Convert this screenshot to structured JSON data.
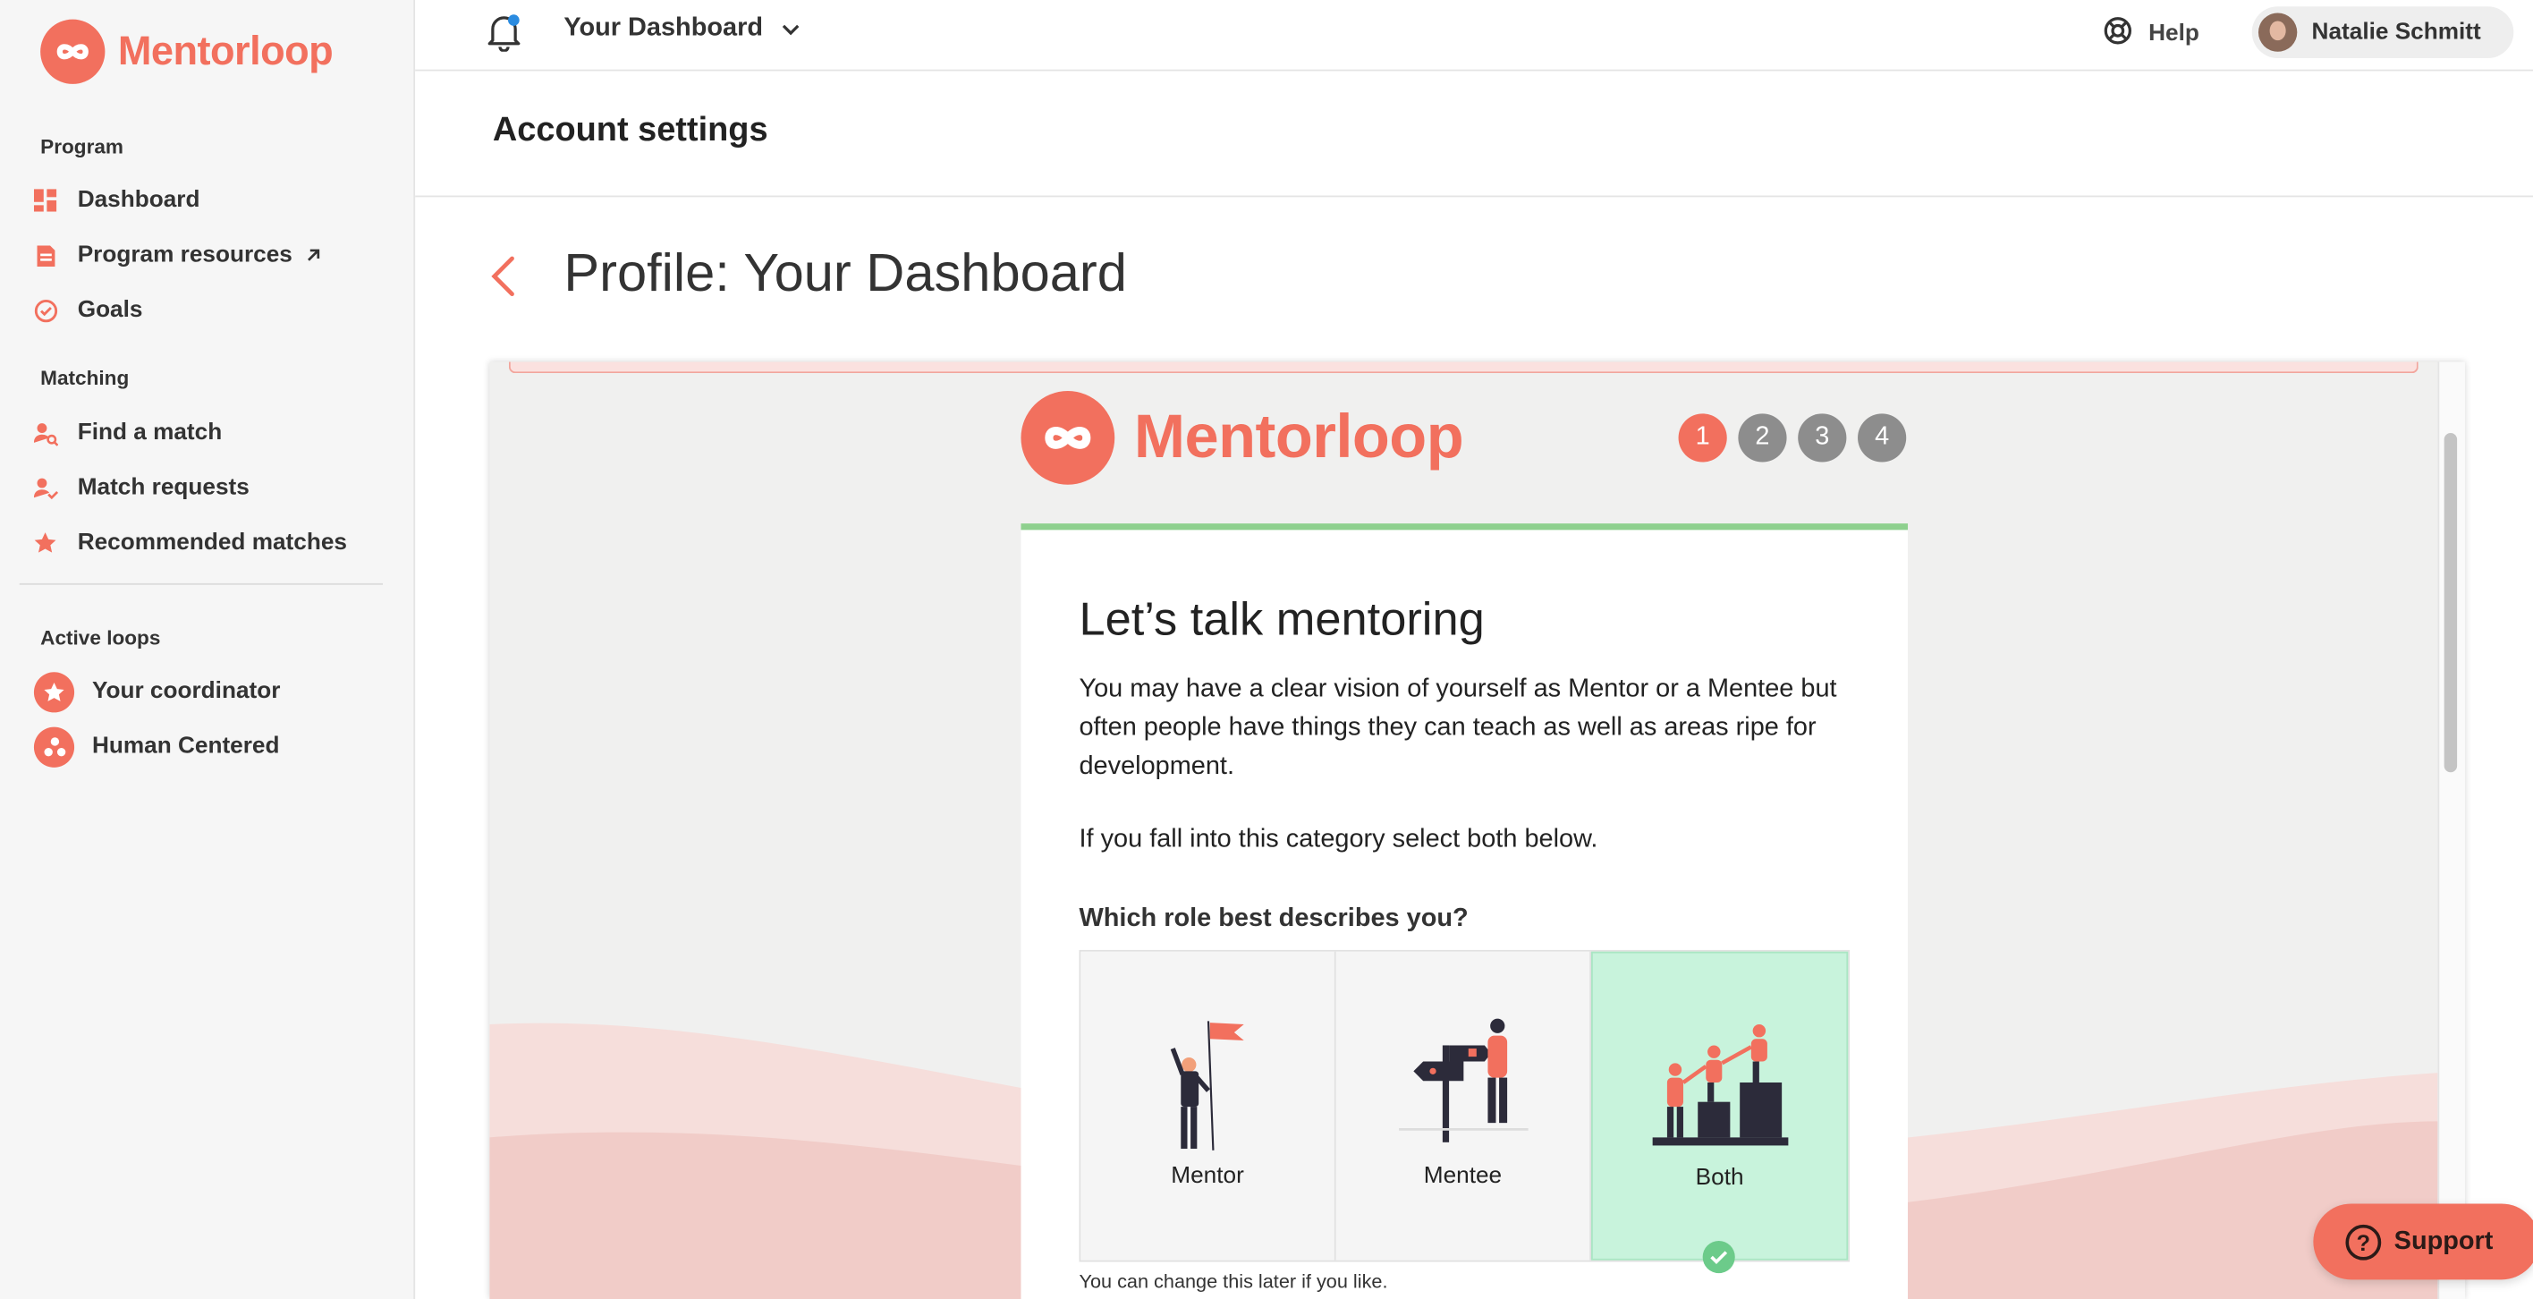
{
  "brand": {
    "name": "Mentorloop",
    "accent": "#f2705e"
  },
  "sidebar": {
    "sections": [
      {
        "title": "Program"
      },
      {
        "title": "Matching"
      },
      {
        "title": "Active loops"
      }
    ],
    "items": [
      {
        "label": "Dashboard",
        "icon": "dashboard-grid-icon"
      },
      {
        "label": "Program resources",
        "icon": "document-icon",
        "external": true
      },
      {
        "label": "Goals",
        "icon": "goal-check-icon"
      },
      {
        "label": "Find a match",
        "icon": "find-person-icon"
      },
      {
        "label": "Match requests",
        "icon": "person-check-icon"
      },
      {
        "label": "Recommended matches",
        "icon": "star-icon"
      },
      {
        "label": "Your coordinator",
        "icon": "star-badge-icon"
      },
      {
        "label": "Human Centered",
        "icon": "group-icon"
      }
    ]
  },
  "topbar": {
    "dashboard_label": "Your Dashboard",
    "help_label": "Help",
    "user_name": "Natalie Schmitt"
  },
  "header": {
    "account_title": "Account settings",
    "page_title": "Profile: Your Dashboard"
  },
  "onboarding": {
    "steps": [
      "1",
      "2",
      "3",
      "4"
    ],
    "active_step": 1,
    "heading": "Let’s talk mentoring",
    "paragraph": "You may have a clear vision of yourself as Mentor or a Mentee but often people have things they can teach as well as areas ripe for development.",
    "paragraph2": "If you fall into this category select both below.",
    "question": "Which role best describes you?",
    "roles": [
      {
        "label": "Mentor",
        "selected": false
      },
      {
        "label": "Mentee",
        "selected": false
      },
      {
        "label": "Both",
        "selected": true
      }
    ],
    "note": "You can change this later if you like."
  },
  "support": {
    "label": "Support"
  }
}
